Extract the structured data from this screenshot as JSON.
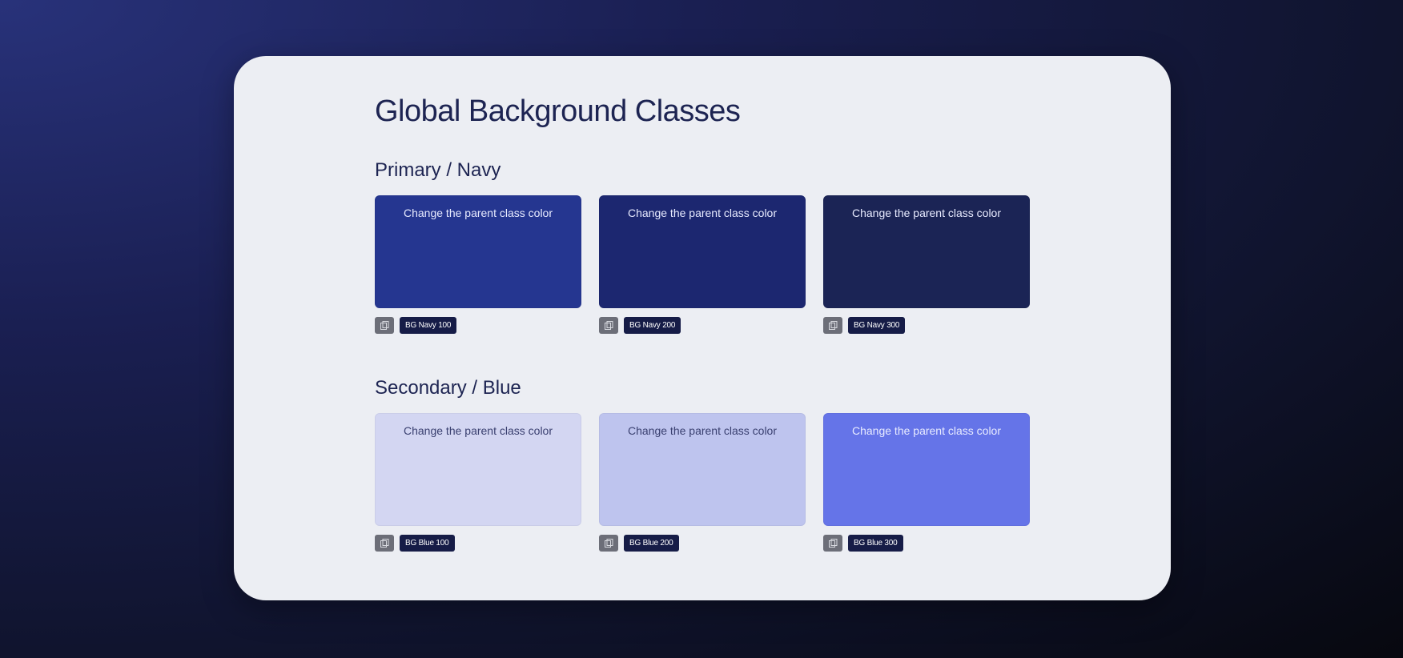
{
  "page": {
    "title": "Global Background Classes"
  },
  "sections": [
    {
      "heading": "Primary / Navy",
      "swatches": [
        {
          "text": "Change the parent class color",
          "label": "BG Navy 100",
          "color": "#253690"
        },
        {
          "text": "Change the parent class color",
          "label": "BG Navy 200",
          "color": "#1c2770"
        },
        {
          "text": "Change the parent class color",
          "label": "BG Navy 300",
          "color": "#1b2455"
        }
      ]
    },
    {
      "heading": "Secondary / Blue",
      "swatches": [
        {
          "text": "Change the parent class color",
          "label": "BG Blue 100",
          "color": "#d3d6f2"
        },
        {
          "text": "Change the parent class color",
          "label": "BG Blue 200",
          "color": "#bec4ee"
        },
        {
          "text": "Change the parent class color",
          "label": "BG Blue 300",
          "color": "#6574e8"
        }
      ]
    }
  ],
  "colors": {
    "tag_icon_bg": "#6c6e78",
    "tag_label_bg": "#161c47",
    "card_bg": "#eceef3",
    "heading_text": "#1d2452"
  },
  "icons": {
    "tag_icon": "copy-icon"
  }
}
